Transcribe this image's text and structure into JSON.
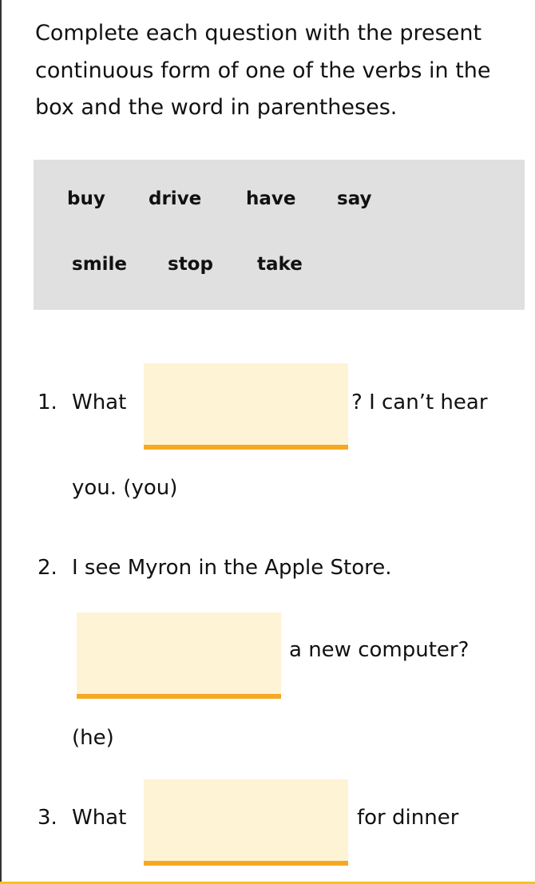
{
  "instructions": [
    "Complete each question with the present",
    "continuous form of one of the verbs in the",
    "box and the word in parentheses."
  ],
  "word_box": {
    "row1": [
      "buy",
      "drive",
      "have",
      "say"
    ],
    "row2": [
      "smile",
      "stop",
      "take"
    ]
  },
  "questions": [
    {
      "number": "1.",
      "before": "What",
      "after": "? I can’t hear",
      "line2": "you. (you)",
      "answer": ""
    },
    {
      "number": "2.",
      "line1": "I see Myron in the Apple Store.",
      "after": "a new computer?",
      "line3": "(he)",
      "answer": ""
    },
    {
      "number": "3.",
      "before": "What",
      "after": "for dinner",
      "answer": ""
    }
  ],
  "colors": {
    "blank_fill": "#fef3d5",
    "blank_underline": "#f7a823",
    "box": "#e0e0e0"
  }
}
